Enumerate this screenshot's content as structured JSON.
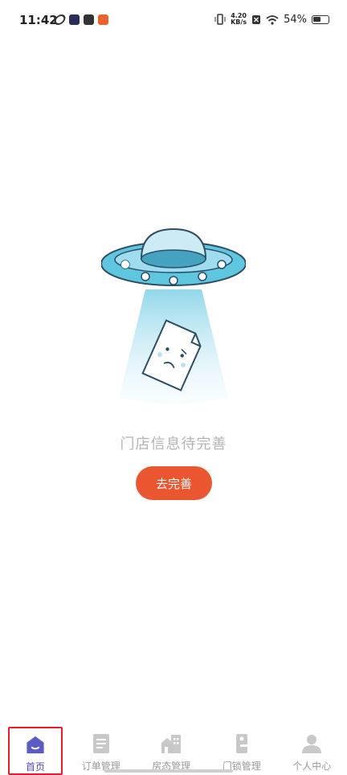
{
  "status_bar": {
    "time": "11:42",
    "net_speed_value": "4.20",
    "net_speed_unit": "KB/s",
    "battery": "54%"
  },
  "empty_state": {
    "message": "门店信息待完善",
    "action_label": "去完善"
  },
  "tabs": [
    {
      "label": "首页",
      "icon": "home-icon",
      "active": true
    },
    {
      "label": "订单管理",
      "icon": "document-icon",
      "active": false
    },
    {
      "label": "房态管理",
      "icon": "building-icon",
      "active": false
    },
    {
      "label": "门锁管理",
      "icon": "door-lock-icon",
      "active": false
    },
    {
      "label": "个人中心",
      "icon": "person-icon",
      "active": false
    }
  ],
  "colors": {
    "accent": "#e9562f",
    "tab_active": "#4f4fb5",
    "tab_inactive": "#9a9a9a",
    "ufo": "#5fc6e0"
  }
}
